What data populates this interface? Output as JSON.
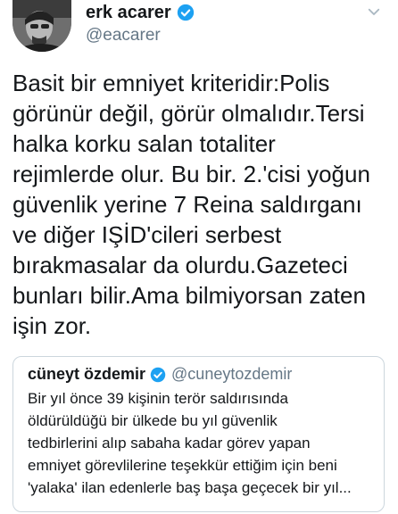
{
  "tweet": {
    "author": {
      "display_name": "erk acarer",
      "handle": "@eacarer",
      "verified": true
    },
    "text": "Basit bir emniyet kriteridir:Polis\ngörünür değil, görür olmalıdır.Tersi\nhalka korku salan totaliter\nrejimlerde olur. Bu bir. 2.'cisi yoğun\ngüvenlik yerine 7 Reina saldırganı\nve diğer IŞİD'cileri serbest\nbırakmasalar da olurdu.Gazeteci\nbunları bilir.Ama bilmiyorsan zaten\nişin zor.",
    "quoted": {
      "display_name": "cüneyt özdemir",
      "handle": "@cuneytozdemir",
      "verified": true,
      "text": "Bir yıl önce 39 kişinin terör saldırısında\nöldürüldüğü bir ülkede bu yıl güvenlik\ntedbirlerini alıp sabaha kadar görev yapan\nemniyet görevlilerine teşekkür ettiğim için beni\n'yalaka' ilan edenlerle baş başa geçecek bir yıl..."
    }
  },
  "icons": {
    "verified": "verified-badge-icon",
    "menu": "chevron-down-icon"
  },
  "colors": {
    "verified_blue": "#1da1f2",
    "secondary_text": "#657786",
    "border": "#ccd6dd"
  }
}
